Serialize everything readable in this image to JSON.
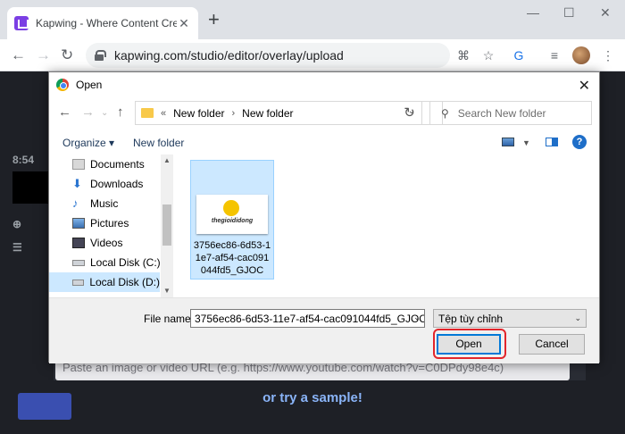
{
  "browser": {
    "tab_title": "Kapwing - Where Content Creati",
    "tab_close": "✕",
    "new_tab": "+",
    "url": "kapwing.com/studio/editor/overlay/upload",
    "window_controls": {
      "minimize": "—",
      "maximize": "☐",
      "close": "✕"
    }
  },
  "page": {
    "time_text": "8:54",
    "url_placeholder": "Paste an image or video URL (e.g. https://www.youtube.com/watch?v=C0DPdy98e4c)",
    "sample_link": "or try a sample!"
  },
  "dialog": {
    "title": "Open",
    "close": "✕",
    "breadcrumb": [
      "New folder",
      "New folder"
    ],
    "breadcrumb_prefix": "«",
    "search_placeholder": "Search New folder",
    "organize_label": "Organize",
    "new_folder_label": "New folder",
    "help": "?",
    "nav_items": [
      {
        "label": "Documents",
        "icon": "documents-icon"
      },
      {
        "label": "Downloads",
        "icon": "downloads-icon"
      },
      {
        "label": "Music",
        "icon": "music-icon"
      },
      {
        "label": "Pictures",
        "icon": "pictures-icon"
      },
      {
        "label": "Videos",
        "icon": "videos-icon"
      },
      {
        "label": "Local Disk (C:)",
        "icon": "disk-icon"
      },
      {
        "label": "Local Disk (D:)",
        "icon": "disk-icon",
        "selected": true
      }
    ],
    "file": {
      "name": "3756ec86-6d53-11e7-af54-cac091044fd5_GJOC",
      "thumbnail_text": "thegioididong"
    },
    "file_name_label": "File name:",
    "file_name_value": "3756ec86-6d53-11e7-af54-cac091044fd5_GJOC",
    "file_type_value": "Tệp tùy chỉnh",
    "open_button": "Open",
    "cancel_button": "Cancel"
  },
  "colors": {
    "selection": "#cce8ff",
    "highlight_ring": "#e2262c",
    "accent": "#0078d7"
  }
}
